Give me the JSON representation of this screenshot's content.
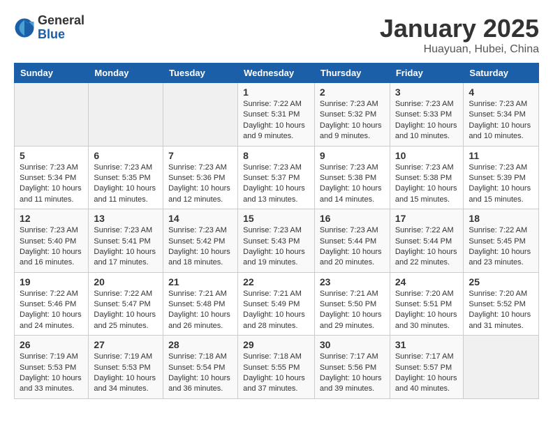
{
  "logo": {
    "general": "General",
    "blue": "Blue"
  },
  "title": "January 2025",
  "location": "Huayuan, Hubei, China",
  "days_of_week": [
    "Sunday",
    "Monday",
    "Tuesday",
    "Wednesday",
    "Thursday",
    "Friday",
    "Saturday"
  ],
  "weeks": [
    [
      {
        "day": "",
        "info": ""
      },
      {
        "day": "",
        "info": ""
      },
      {
        "day": "",
        "info": ""
      },
      {
        "day": "1",
        "info": "Sunrise: 7:22 AM\nSunset: 5:31 PM\nDaylight: 10 hours\nand 9 minutes."
      },
      {
        "day": "2",
        "info": "Sunrise: 7:23 AM\nSunset: 5:32 PM\nDaylight: 10 hours\nand 9 minutes."
      },
      {
        "day": "3",
        "info": "Sunrise: 7:23 AM\nSunset: 5:33 PM\nDaylight: 10 hours\nand 10 minutes."
      },
      {
        "day": "4",
        "info": "Sunrise: 7:23 AM\nSunset: 5:34 PM\nDaylight: 10 hours\nand 10 minutes."
      }
    ],
    [
      {
        "day": "5",
        "info": "Sunrise: 7:23 AM\nSunset: 5:34 PM\nDaylight: 10 hours\nand 11 minutes."
      },
      {
        "day": "6",
        "info": "Sunrise: 7:23 AM\nSunset: 5:35 PM\nDaylight: 10 hours\nand 11 minutes."
      },
      {
        "day": "7",
        "info": "Sunrise: 7:23 AM\nSunset: 5:36 PM\nDaylight: 10 hours\nand 12 minutes."
      },
      {
        "day": "8",
        "info": "Sunrise: 7:23 AM\nSunset: 5:37 PM\nDaylight: 10 hours\nand 13 minutes."
      },
      {
        "day": "9",
        "info": "Sunrise: 7:23 AM\nSunset: 5:38 PM\nDaylight: 10 hours\nand 14 minutes."
      },
      {
        "day": "10",
        "info": "Sunrise: 7:23 AM\nSunset: 5:38 PM\nDaylight: 10 hours\nand 15 minutes."
      },
      {
        "day": "11",
        "info": "Sunrise: 7:23 AM\nSunset: 5:39 PM\nDaylight: 10 hours\nand 15 minutes."
      }
    ],
    [
      {
        "day": "12",
        "info": "Sunrise: 7:23 AM\nSunset: 5:40 PM\nDaylight: 10 hours\nand 16 minutes."
      },
      {
        "day": "13",
        "info": "Sunrise: 7:23 AM\nSunset: 5:41 PM\nDaylight: 10 hours\nand 17 minutes."
      },
      {
        "day": "14",
        "info": "Sunrise: 7:23 AM\nSunset: 5:42 PM\nDaylight: 10 hours\nand 18 minutes."
      },
      {
        "day": "15",
        "info": "Sunrise: 7:23 AM\nSunset: 5:43 PM\nDaylight: 10 hours\nand 19 minutes."
      },
      {
        "day": "16",
        "info": "Sunrise: 7:23 AM\nSunset: 5:44 PM\nDaylight: 10 hours\nand 20 minutes."
      },
      {
        "day": "17",
        "info": "Sunrise: 7:22 AM\nSunset: 5:44 PM\nDaylight: 10 hours\nand 22 minutes."
      },
      {
        "day": "18",
        "info": "Sunrise: 7:22 AM\nSunset: 5:45 PM\nDaylight: 10 hours\nand 23 minutes."
      }
    ],
    [
      {
        "day": "19",
        "info": "Sunrise: 7:22 AM\nSunset: 5:46 PM\nDaylight: 10 hours\nand 24 minutes."
      },
      {
        "day": "20",
        "info": "Sunrise: 7:22 AM\nSunset: 5:47 PM\nDaylight: 10 hours\nand 25 minutes."
      },
      {
        "day": "21",
        "info": "Sunrise: 7:21 AM\nSunset: 5:48 PM\nDaylight: 10 hours\nand 26 minutes."
      },
      {
        "day": "22",
        "info": "Sunrise: 7:21 AM\nSunset: 5:49 PM\nDaylight: 10 hours\nand 28 minutes."
      },
      {
        "day": "23",
        "info": "Sunrise: 7:21 AM\nSunset: 5:50 PM\nDaylight: 10 hours\nand 29 minutes."
      },
      {
        "day": "24",
        "info": "Sunrise: 7:20 AM\nSunset: 5:51 PM\nDaylight: 10 hours\nand 30 minutes."
      },
      {
        "day": "25",
        "info": "Sunrise: 7:20 AM\nSunset: 5:52 PM\nDaylight: 10 hours\nand 31 minutes."
      }
    ],
    [
      {
        "day": "26",
        "info": "Sunrise: 7:19 AM\nSunset: 5:53 PM\nDaylight: 10 hours\nand 33 minutes."
      },
      {
        "day": "27",
        "info": "Sunrise: 7:19 AM\nSunset: 5:53 PM\nDaylight: 10 hours\nand 34 minutes."
      },
      {
        "day": "28",
        "info": "Sunrise: 7:18 AM\nSunset: 5:54 PM\nDaylight: 10 hours\nand 36 minutes."
      },
      {
        "day": "29",
        "info": "Sunrise: 7:18 AM\nSunset: 5:55 PM\nDaylight: 10 hours\nand 37 minutes."
      },
      {
        "day": "30",
        "info": "Sunrise: 7:17 AM\nSunset: 5:56 PM\nDaylight: 10 hours\nand 39 minutes."
      },
      {
        "day": "31",
        "info": "Sunrise: 7:17 AM\nSunset: 5:57 PM\nDaylight: 10 hours\nand 40 minutes."
      },
      {
        "day": "",
        "info": ""
      }
    ]
  ]
}
